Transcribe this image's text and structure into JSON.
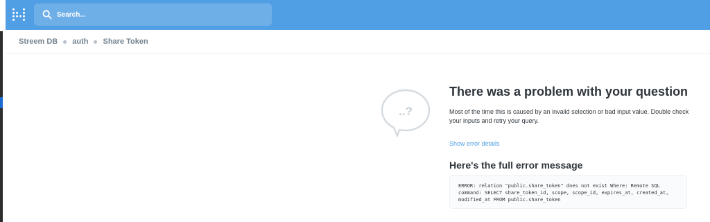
{
  "search": {
    "placeholder": "Search..."
  },
  "breadcrumb": [
    {
      "label": "Streem DB"
    },
    {
      "label": "auth"
    },
    {
      "label": "Share Token"
    }
  ],
  "error": {
    "title": "There was a problem with your question",
    "description": "Most of the time this is caused by an invalid selection or bad input value. Double check your inputs and retry your query.",
    "details_link": "Show error details",
    "full_title": "Here's the full error message",
    "message": "ERROR: relation \"public.share_token\" does not exist Where: Remote SQL command: SELECT share_token_id, scope, scope_id, expires_at, created_at, modified_at FROM public.share_token",
    "icon_text": "..?"
  },
  "colors": {
    "nav": "#509ee3",
    "link": "#509ee3",
    "text": "#2e353b",
    "muted": "#74838f"
  },
  "icons": [
    "logo-icon",
    "search-icon",
    "question-bubble-icon"
  ]
}
